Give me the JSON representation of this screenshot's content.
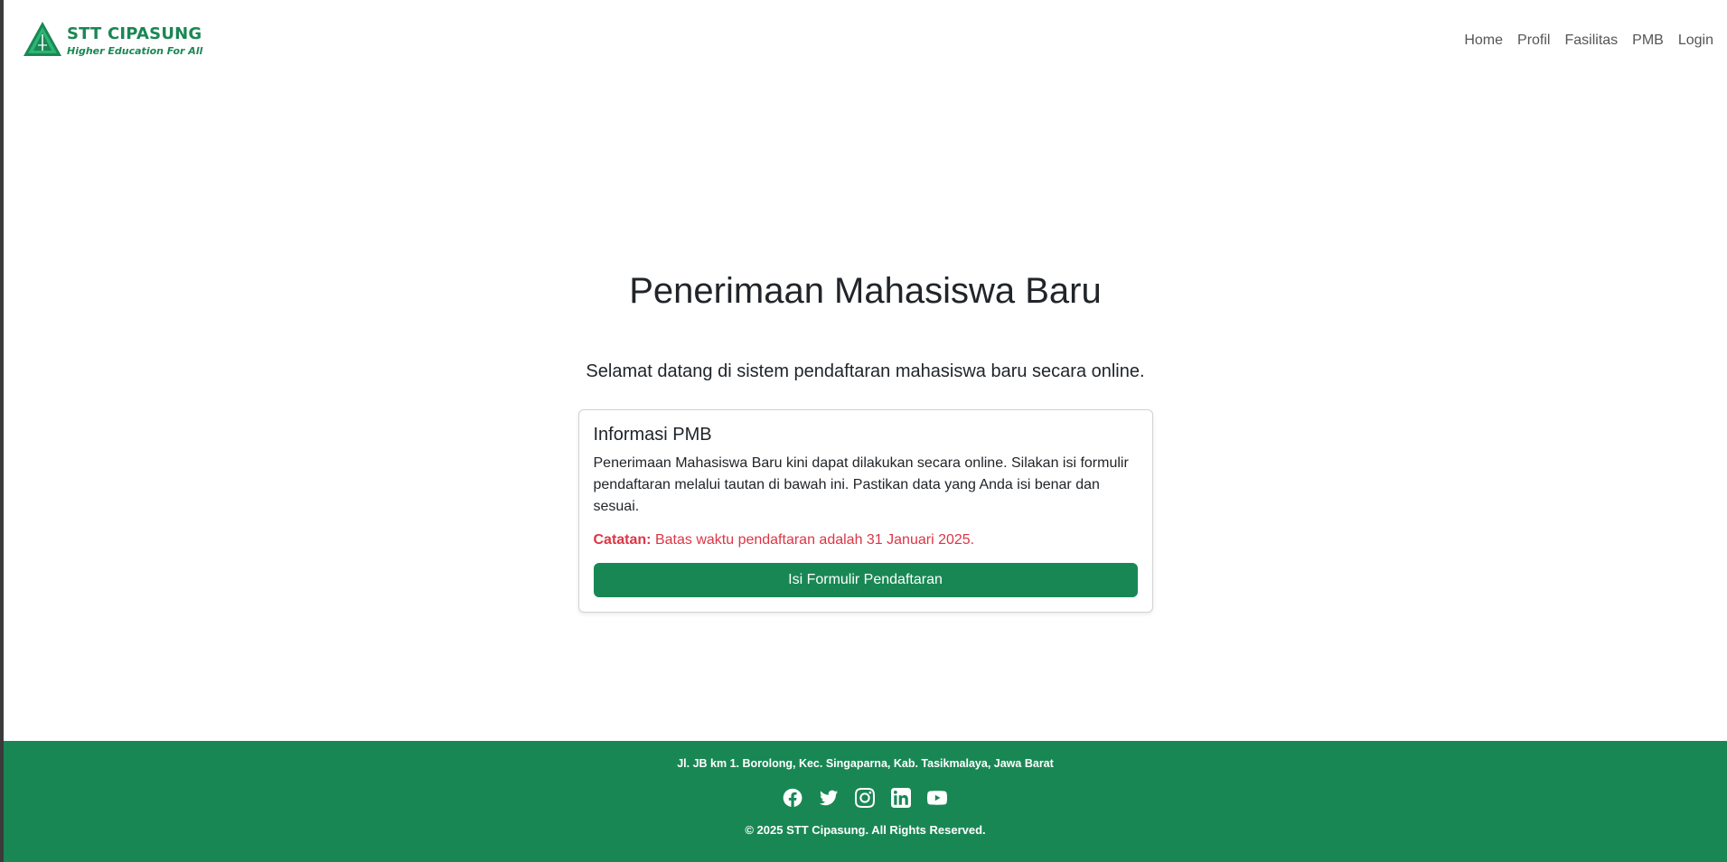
{
  "brand": {
    "name": "STT CIPASUNG",
    "tagline": "Higher Education For All"
  },
  "nav": {
    "items": [
      "Home",
      "Profil",
      "Fasilitas",
      "PMB",
      "Login"
    ]
  },
  "main": {
    "title": "Penerimaan Mahasiswa Baru",
    "lead": "Selamat datang di sistem pendaftaran mahasiswa baru secara online.",
    "card": {
      "title": "Informasi PMB",
      "text": "Penerimaan Mahasiswa Baru kini dapat dilakukan secara online. Silakan isi formulir pendaftaran melalui tautan di bawah ini. Pastikan data yang Anda isi benar dan sesuai.",
      "note_label": "Catatan:",
      "note_text": " Batas waktu pendaftaran adalah 31 Januari 2025.",
      "button_label": "Isi Formulir Pendaftaran"
    }
  },
  "footer": {
    "address": "Jl. JB km 1. Borolong, Kec. Singaparna, Kab. Tasikmalaya, Jawa Barat",
    "social": [
      "facebook-icon",
      "twitter-icon",
      "instagram-icon",
      "linkedin-icon",
      "youtube-icon"
    ],
    "copyright": "© 2025 STT Cipasung. All Rights Reserved."
  },
  "colors": {
    "primary": "#198754",
    "danger": "#dc3545",
    "text": "#212529"
  }
}
